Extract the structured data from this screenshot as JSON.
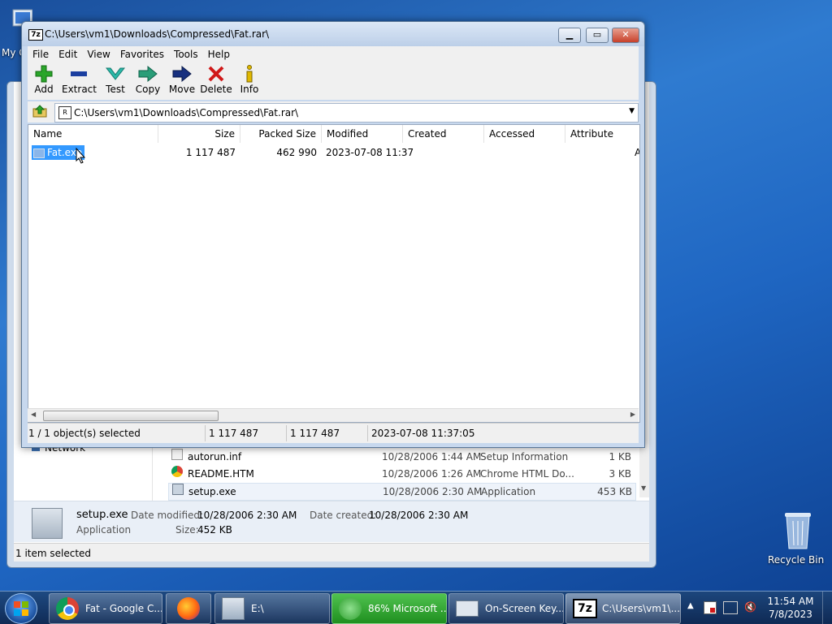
{
  "desktop": {
    "my_computer_label": "My C",
    "recycle_bin_label": "Recycle Bin"
  },
  "explorer": {
    "nav_network": "Network",
    "files": [
      {
        "name": "autorun.inf",
        "date": "10/28/2006 1:44 AM",
        "type": "Setup Information",
        "size": "1 KB",
        "icon": "inf-file-icon"
      },
      {
        "name": "README.HTM",
        "date": "10/28/2006 1:26 AM",
        "type": "Chrome HTML Do...",
        "size": "3 KB",
        "icon": "chrome-icon"
      },
      {
        "name": "setup.exe",
        "date": "10/28/2006 2:30 AM",
        "type": "Application",
        "size": "453 KB",
        "icon": "setup-icon"
      }
    ],
    "details": {
      "name": "setup.exe",
      "type": "Application",
      "date_modified_label": "Date modified:",
      "date_modified": "10/28/2006 2:30 AM",
      "date_created_label": "Date created:",
      "date_created": "10/28/2006 2:30 AM",
      "size_label": "Size:",
      "size": "452 KB"
    },
    "status": "1 item selected"
  },
  "zip": {
    "title": "C:\\Users\\vm1\\Downloads\\Compressed\\Fat.rar\\",
    "menu": [
      "File",
      "Edit",
      "View",
      "Favorites",
      "Tools",
      "Help"
    ],
    "toolbar": [
      "Add",
      "Extract",
      "Test",
      "Copy",
      "Move",
      "Delete",
      "Info"
    ],
    "address": "C:\\Users\\vm1\\Downloads\\Compressed\\Fat.rar\\",
    "columns": [
      "Name",
      "Size",
      "Packed Size",
      "Modified",
      "Created",
      "Accessed",
      "Attribute"
    ],
    "rows": [
      {
        "name": "Fat.exe",
        "size": "1 117 487",
        "packed": "462 990",
        "modified": "2023-07-08 11:37",
        "created": "",
        "accessed": "",
        "attr": "A"
      }
    ],
    "status": {
      "selected": "1 / 1 object(s) selected",
      "size": "1 117 487",
      "packed": "1 117 487",
      "modified": "2023-07-08 11:37:05"
    }
  },
  "taskbar": {
    "items": [
      {
        "label": "Fat - Google C...",
        "icon": "chrome-icon"
      },
      {
        "label": "",
        "icon": "firefox-icon"
      },
      {
        "label": "E:\\",
        "icon": "drive-icon"
      },
      {
        "label": "86% Microsoft ...",
        "icon": "download-icon"
      },
      {
        "label": "On-Screen Key...",
        "icon": "keyboard-icon"
      },
      {
        "label": "C:\\Users\\vm1\\...",
        "icon": "7zip-icon"
      }
    ],
    "clock_time": "11:54 AM",
    "clock_date": "7/8/2023"
  },
  "colors": {
    "selection": "#3399ff",
    "add_green": "#2aa52a",
    "extract_blue": "#1b3fa0",
    "delete_red": "#d01818"
  }
}
